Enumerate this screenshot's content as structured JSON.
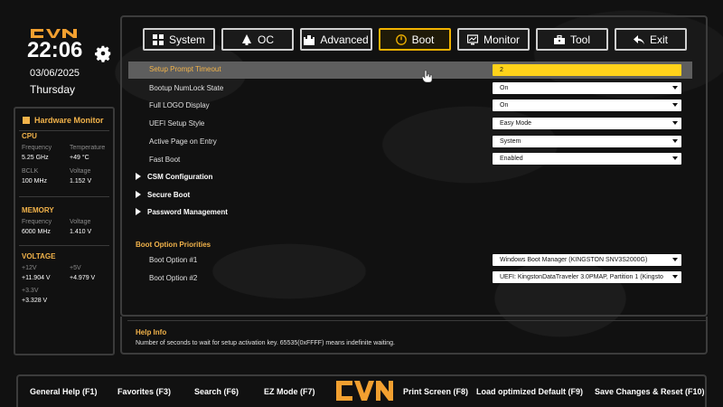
{
  "brand": {
    "logo_text": "CVN"
  },
  "clock": {
    "time": "22:06",
    "date": "03/06/2025",
    "weekday": "Thursday"
  },
  "hardware_monitor": {
    "title": "Hardware Monitor",
    "cpu": {
      "title": "CPU",
      "frequency_label": "Frequency",
      "frequency": "5.25 GHz",
      "temperature_label": "Temperature",
      "temperature": "+49 °C",
      "bclk_label": "BCLK",
      "bclk": "100 MHz",
      "voltage_label": "Voltage",
      "voltage": "1.152 V"
    },
    "memory": {
      "title": "MEMORY",
      "frequency_label": "Frequency",
      "frequency": "6000 MHz",
      "voltage_label": "Voltage",
      "voltage": "1.410 V"
    },
    "voltage": {
      "title": "VOLTAGE",
      "v12_label": "+12V",
      "v12": "+11.904 V",
      "v5_label": "+5V",
      "v5": "+4.979 V",
      "v33_label": "+3.3V",
      "v33": "+3.328 V"
    }
  },
  "tabs": [
    {
      "label": "System",
      "icon": "grid-icon",
      "active": false
    },
    {
      "label": "OC",
      "icon": "bell-icon",
      "active": false
    },
    {
      "label": "Advanced",
      "icon": "castle-icon",
      "active": false
    },
    {
      "label": "Boot",
      "icon": "power-icon",
      "active": true
    },
    {
      "label": "Monitor",
      "icon": "monitor-icon",
      "active": false
    },
    {
      "label": "Tool",
      "icon": "toolbox-icon",
      "active": false
    },
    {
      "label": "Exit",
      "icon": "back-arrow-icon",
      "active": false
    }
  ],
  "settings": {
    "setup_prompt_timeout": {
      "label": "Setup Prompt Timeout",
      "value": "2"
    },
    "bootup_numlock": {
      "label": "Bootup NumLock State",
      "value": "On"
    },
    "full_logo": {
      "label": "Full LOGO Display",
      "value": "On"
    },
    "uefi_setup_style": {
      "label": "UEFI Setup Style",
      "value": "Easy Mode"
    },
    "active_page": {
      "label": "Active Page on Entry",
      "value": "System"
    },
    "fast_boot": {
      "label": "Fast Boot",
      "value": "Enabled"
    }
  },
  "submenus": {
    "csm": "CSM Configuration",
    "secure_boot": "Secure Boot",
    "password": "Password Management"
  },
  "boot_priorities": {
    "title": "Boot Option Priorities",
    "option1": {
      "label": "Boot Option #1",
      "value": "Windows Boot Manager (KINGSTON SNV3S2000G)"
    },
    "option2": {
      "label": "Boot Option #2",
      "value": "UEFI: KingstonDataTraveler 3.0PMAP, Partition 1 (Kingsto"
    }
  },
  "help": {
    "title": "Help Info",
    "text": "Number of seconds to wait for setup activation key. 65535(0xFFFF) means indefinite waiting."
  },
  "function_keys": {
    "general_help": "General Help (F1)",
    "favorites": "Favorites (F3)",
    "search": "Search (F6)",
    "ez_mode": "EZ Mode (F7)",
    "print_screen": "Print Screen (F8)",
    "load_defaults": "Load optimized Default (F9)",
    "save_reset": "Save Changes & Reset (F10)"
  },
  "colors": {
    "accent": "#f2b34a",
    "active_tab": "#f2b300",
    "input_highlight": "#ffd21a"
  }
}
